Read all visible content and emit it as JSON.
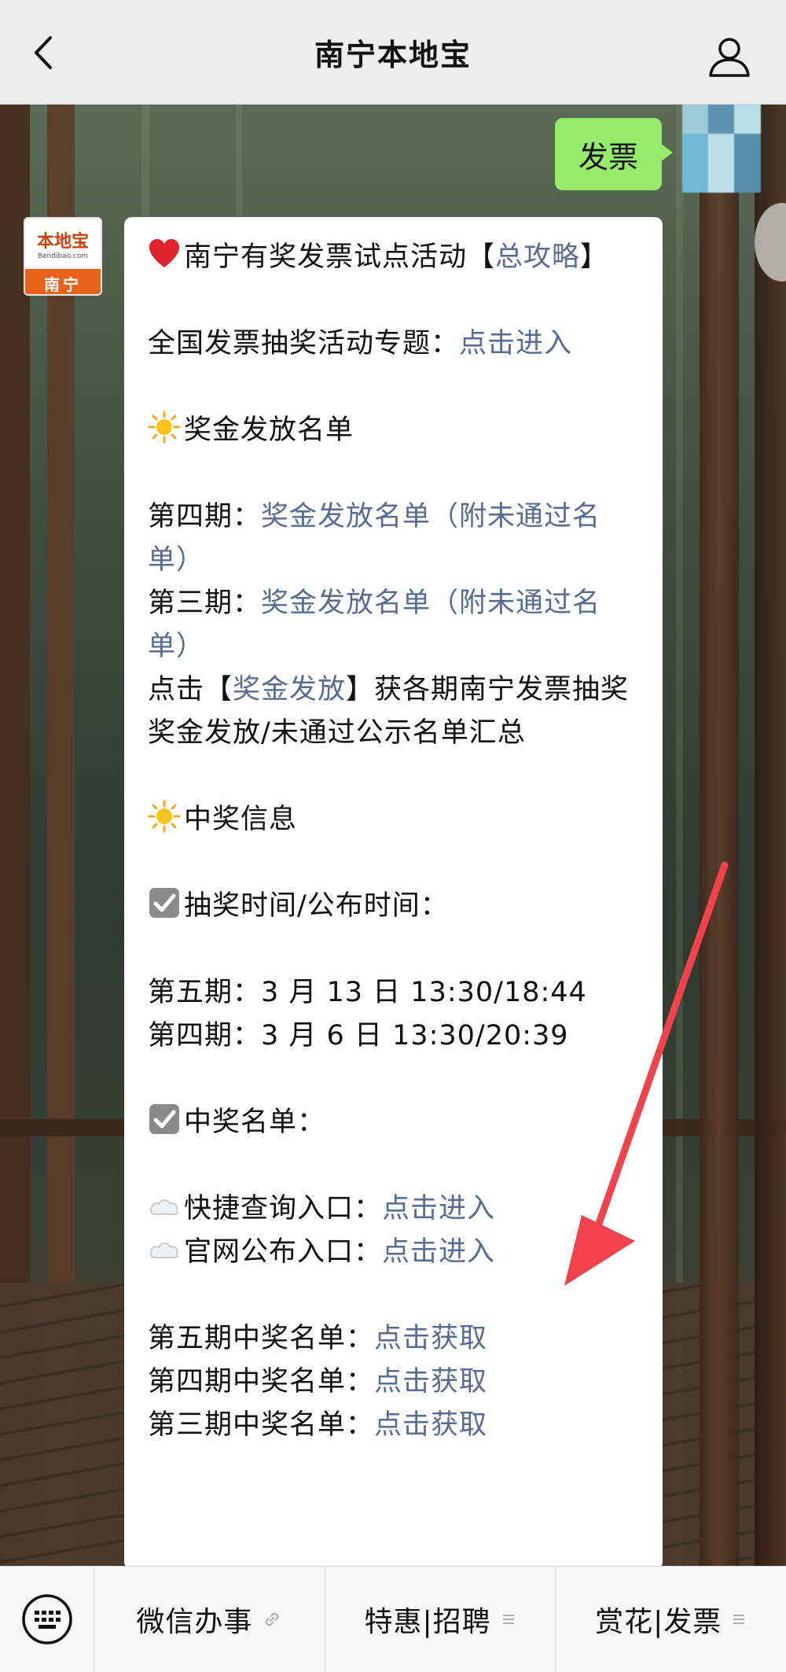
{
  "header": {
    "title": "南宁本地宝"
  },
  "sent": {
    "text": "发票"
  },
  "bot": {
    "brand": "本地宝",
    "site": "Bendibao.com",
    "city": "南宁"
  },
  "message": {
    "title_text": "南宁有奖发票试点活动【",
    "title_link": "总攻略",
    "title_end": "】",
    "national_label": "全国发票抽奖活动专题：",
    "national_link": "点击进入",
    "bonus_heading": "奖金发放名单",
    "p4_label": "第四期：",
    "p4_link": "奖金发放名单（附未通过名单）",
    "p3_label": "第三期：",
    "p3_link": "奖金发放名单（附未通过名单）",
    "click_prefix": "点击【",
    "click_link": "奖金发放",
    "click_suffix": "】获各期南宁发票抽奖奖金发放/未通过公示名单汇总",
    "win_info_heading": "中奖信息",
    "draw_time_heading": "抽奖时间/公布时间：",
    "draw5": "第五期：3 月 13 日 13:30/18:44",
    "draw4": "第四期：3 月 6 日 13:30/20:39",
    "winners_heading": "中奖名单：",
    "quick_label": "快捷查询入口：",
    "quick_link": "点击进入",
    "official_label": "官网公布入口：",
    "official_link": "点击进入",
    "list5_label": "第五期中奖名单：",
    "list5_link": "点击获取",
    "list4_label": "第四期中奖名单：",
    "list4_link": "点击获取",
    "list3_label": "第三期中奖名单：",
    "list3_link": "点击获取"
  },
  "bottom_menu": [
    {
      "label": "微信办事",
      "icon": "link-icon"
    },
    {
      "label": "特惠|招聘",
      "icon": "menu-lines-icon"
    },
    {
      "label": "赏花|发票",
      "icon": "menu-lines-icon"
    }
  ],
  "colors": {
    "link": "#576b95",
    "sent_bubble": "#95ec69",
    "arrow": "#f2434d",
    "brand_orange": "#e8621a"
  }
}
